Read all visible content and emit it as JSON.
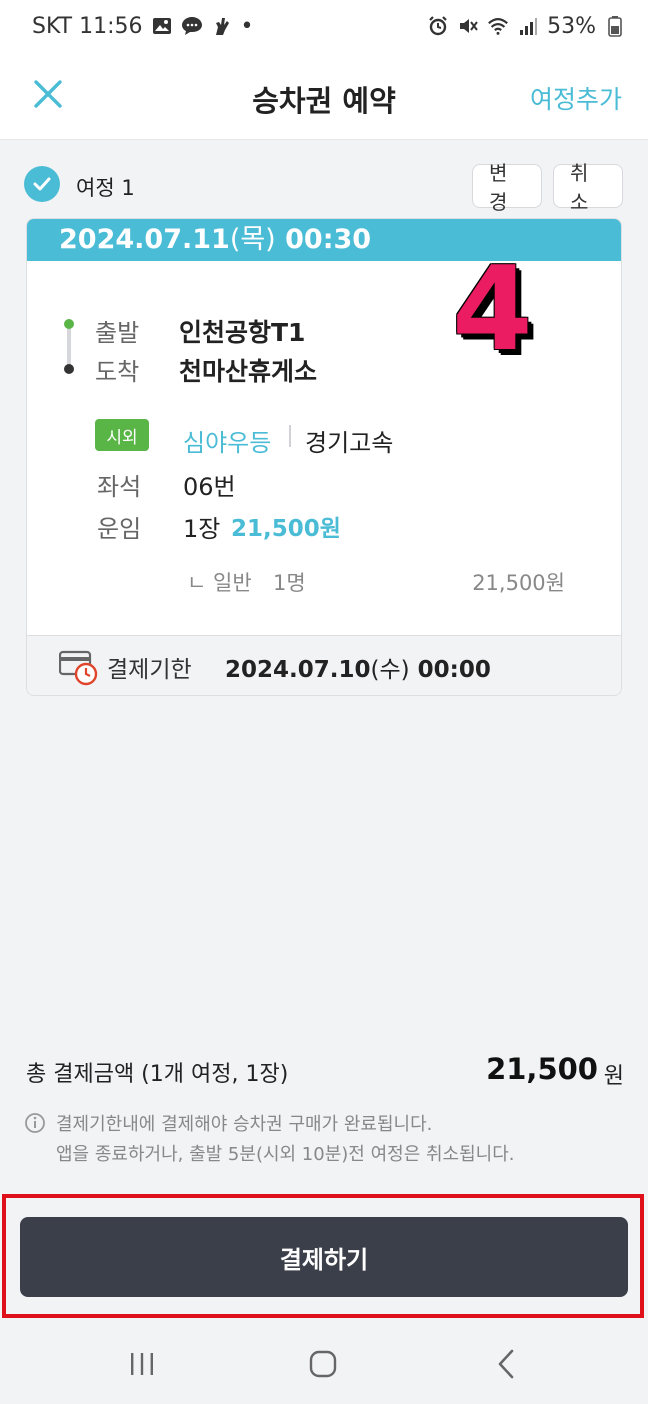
{
  "status_bar": {
    "carrier_time": "SKT 11:56",
    "dot": "•",
    "battery": "53%",
    "left_icons": [
      "gallery-icon",
      "chat-icon",
      "hand-icon"
    ],
    "right_icons": [
      "alarm-icon",
      "mute-icon",
      "wifi-icon",
      "signal-icon",
      "battery-icon"
    ]
  },
  "header": {
    "title": "승차권 예약",
    "add_trip_label": "여정추가",
    "close_icon": "close-icon"
  },
  "trip": {
    "label": "여정 1",
    "change_label": "변경",
    "cancel_label": "취소",
    "date": "2024.07.11",
    "weekday": "(목)",
    "time": "00:30",
    "departure_label": "출발",
    "departure_value": "인천공항T1",
    "arrival_label": "도착",
    "arrival_value": "천마산휴게소",
    "badge": "시외",
    "bus_class": "심야우등",
    "operator": "경기고속",
    "seat_label": "좌석",
    "seat_value": "06번",
    "fare_label": "운임",
    "fare_count": "1장",
    "fare_amount": "21,500원",
    "fare_sub_type": "ㄴ 일반",
    "fare_sub_count": "1명",
    "fare_sub_amount": "21,500원",
    "deadline_label": "결제기한",
    "deadline_date": "2024.07.10",
    "deadline_weekday": "(수)",
    "deadline_time": "00:00"
  },
  "overlay": {
    "step_number": "4",
    "color": "#ec1c63"
  },
  "total": {
    "label": "총 결제금액 (1개 여정, 1장)",
    "amount": "21,500",
    "unit": "원"
  },
  "notice": {
    "line1": "결제기한내에 결제해야 승차권 구매가 완료됩니다.",
    "line2": "앱을 종료하거나, 출발 5분(시외 10분)전 여정은 취소됩니다."
  },
  "pay_button": {
    "label": "결제하기"
  },
  "nav": {
    "icons": [
      "recent-apps-icon",
      "home-icon",
      "back-icon"
    ]
  },
  "colors": {
    "accent": "#4bbcd6",
    "green": "#5ab547",
    "button": "#3b3f49",
    "highlight": "#e0101a"
  }
}
